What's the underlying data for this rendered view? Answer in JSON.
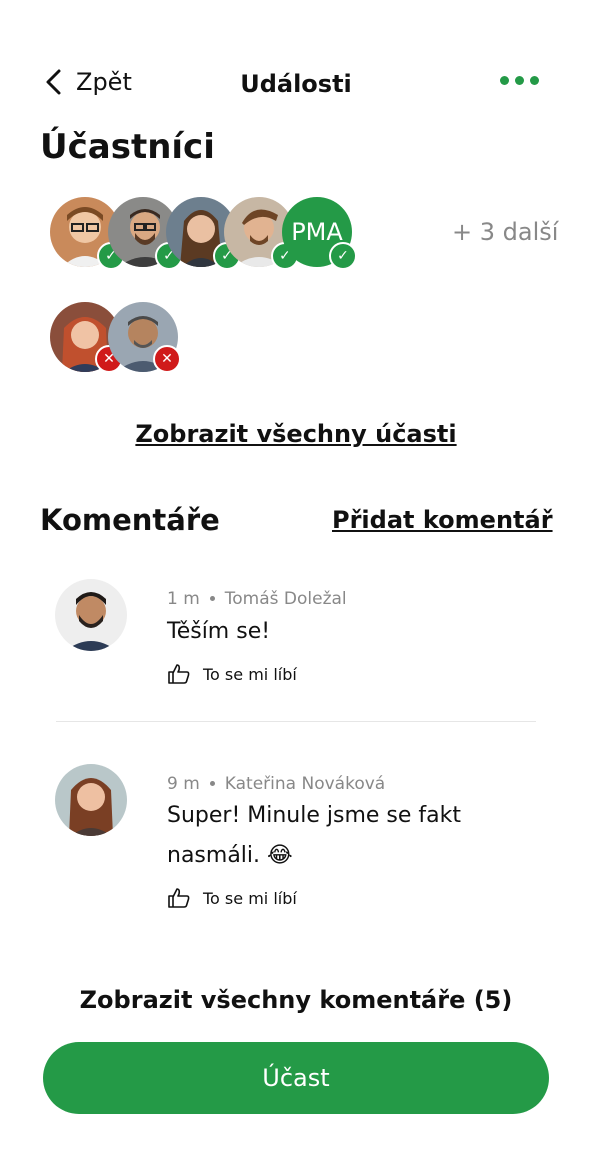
{
  "header": {
    "back_label": "Zpět",
    "title": "Události"
  },
  "participants": {
    "title": "Účastníci",
    "attending_initials": "PMA",
    "more_label": "+ 3 další",
    "show_all_label": "Zobrazit všechny účasti"
  },
  "comments": {
    "title": "Komentáře",
    "add_label": "Přidat komentář",
    "items": [
      {
        "time": "1 m",
        "author": "Tomáš Doležal",
        "text": "Těším se!",
        "like_label": "To se mi líbí"
      },
      {
        "time": "9 m",
        "author": "Kateřina Nováková",
        "text": "Super! Minule jsme se fakt nasmáli. 😂",
        "like_label": "To se mi líbí"
      }
    ],
    "show_all_label": "Zobrazit všechny komentáře (5)"
  },
  "cta": {
    "label": "Účast"
  },
  "colors": {
    "accent": "#249a47",
    "declined": "#d01a1a"
  }
}
